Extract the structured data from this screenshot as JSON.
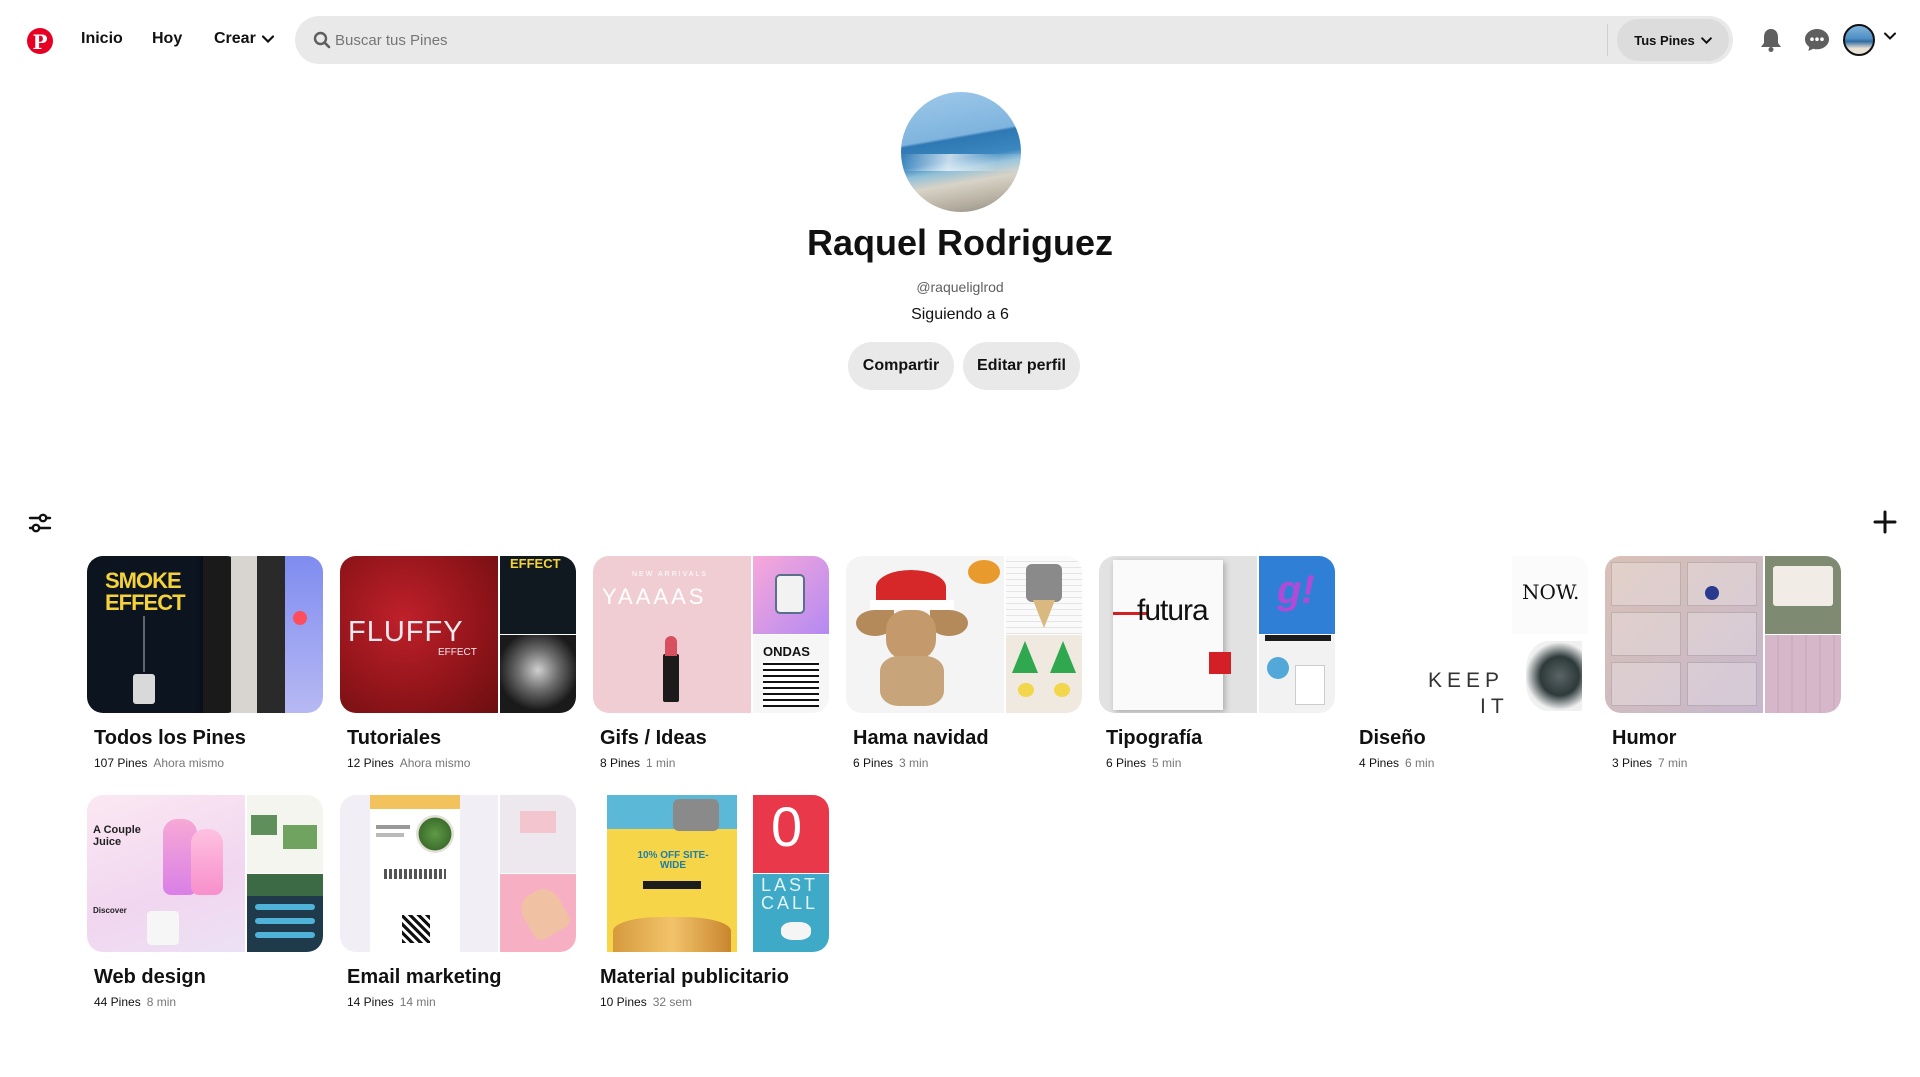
{
  "nav": {
    "home": "Inicio",
    "today": "Hoy",
    "create": "Crear"
  },
  "search": {
    "placeholder": "Buscar tus Pines",
    "scope": "Tus Pines"
  },
  "profile": {
    "name": "Raquel Rodriguez",
    "handle": "@raqueliglrod",
    "following": "Siguiendo a 6",
    "share_label": "Compartir",
    "edit_label": "Editar perfil"
  },
  "colors": {
    "brand": "#e60023",
    "pill": "#e9e9e9"
  },
  "boards": [
    {
      "title": "Todos los Pines",
      "count": "107 Pines",
      "time": "Ahora mismo",
      "cover_text": "SMOKE EFFECT"
    },
    {
      "title": "Tutoriales",
      "count": "12 Pines",
      "time": "Ahora mismo",
      "cover_text": "FLUFFY",
      "cover_sub": "EFFECT",
      "cover_tr": "EFFECT"
    },
    {
      "title": "Gifs / Ideas",
      "count": "8 Pines",
      "time": "1 min",
      "cover_text": "YAAAAS",
      "cover_sub": "NEW ARRIVALS",
      "cover_br": "ONDAS"
    },
    {
      "title": "Hama navidad",
      "count": "6 Pines",
      "time": "3 min"
    },
    {
      "title": "Tipografía",
      "count": "6 Pines",
      "time": "5 min",
      "cover_text": "futura",
      "cover_tr": "g!"
    },
    {
      "title": "Diseño",
      "count": "4 Pines",
      "time": "6 min",
      "cover_text": "KEEP",
      "cover_sub": "IT",
      "cover_tr": "NOW."
    },
    {
      "title": "Humor",
      "count": "3 Pines",
      "time": "7 min"
    },
    {
      "title": "Web design",
      "count": "44 Pines",
      "time": "8 min",
      "cover_text": "A Couple Juice",
      "cover_sub": "Discover"
    },
    {
      "title": "Email marketing",
      "count": "14 Pines",
      "time": "14 min"
    },
    {
      "title": "Material publicitario",
      "count": "10 Pines",
      "time": "32 sem",
      "cover_text": "10% OFF SITE-WIDE",
      "cover_tr": "0",
      "cover_br": "LAST CALL"
    }
  ]
}
